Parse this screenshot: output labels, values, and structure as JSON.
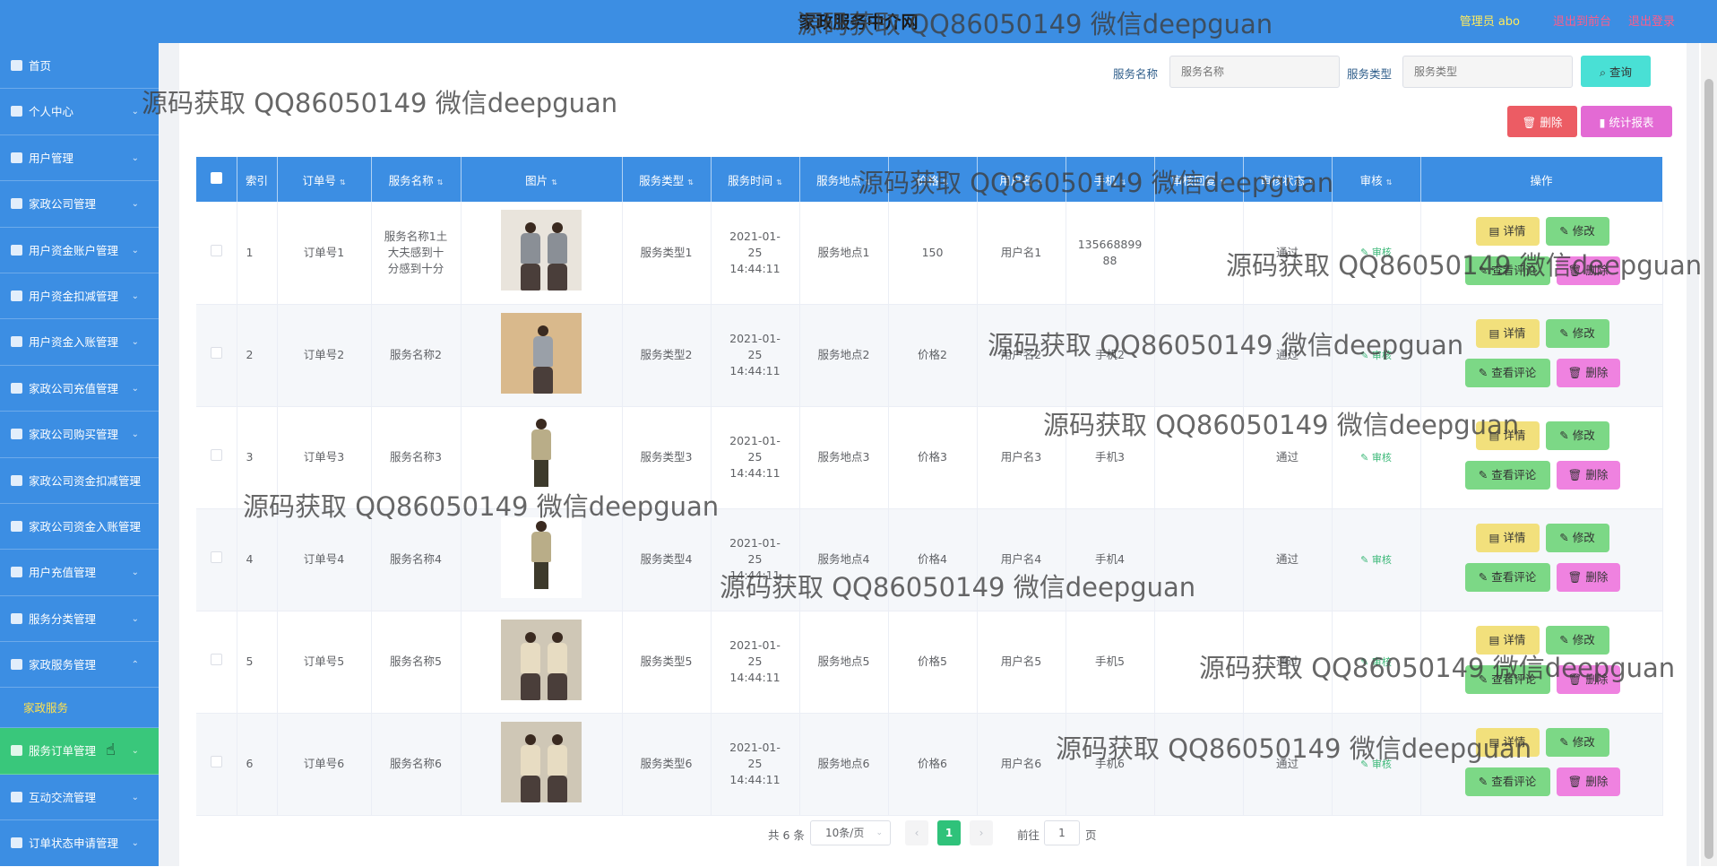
{
  "header": {
    "title": "家政服务中介网",
    "admin_label": "管理员 abo",
    "front_label": "退出到前台",
    "logout_label": "退出登录"
  },
  "sidebar": {
    "items": [
      {
        "label": "首页",
        "arrow": ""
      },
      {
        "label": "个人中心",
        "arrow": "⌄"
      },
      {
        "label": "用户管理",
        "arrow": "⌄"
      },
      {
        "label": "家政公司管理",
        "arrow": "⌄"
      },
      {
        "label": "用户资金账户管理",
        "arrow": "⌄"
      },
      {
        "label": "用户资金扣减管理",
        "arrow": "⌄"
      },
      {
        "label": "用户资金入账管理",
        "arrow": "⌄"
      },
      {
        "label": "家政公司充值管理",
        "arrow": "⌄"
      },
      {
        "label": "家政公司购买管理",
        "arrow": "⌄"
      },
      {
        "label": "家政公司资金扣减管理",
        "arrow": "⌄"
      },
      {
        "label": "家政公司资金入账管理",
        "arrow": "⌄"
      },
      {
        "label": "用户充值管理",
        "arrow": "⌄"
      },
      {
        "label": "服务分类管理",
        "arrow": "⌄"
      },
      {
        "label": "家政服务管理",
        "arrow": "⌃"
      }
    ],
    "sub_item": "家政服务",
    "tail_items": [
      {
        "label": "服务订单管理",
        "arrow": "⌄",
        "active": true
      },
      {
        "label": "互动交流管理",
        "arrow": "⌄"
      },
      {
        "label": "订单状态申请管理",
        "arrow": "⌄"
      }
    ]
  },
  "search": {
    "name_label": "服务名称",
    "name_placeholder": "服务名称",
    "type_label": "服务类型",
    "type_placeholder": "服务类型",
    "query_label": "⌕ 查询",
    "delete_label": "🗑 删除",
    "report_label": "▮ 统计报表"
  },
  "table": {
    "headers": [
      "索引",
      "订单号",
      "服务名称",
      "图片",
      "服务类型",
      "服务时间",
      "服务地点",
      "价格",
      "用户名",
      "手机",
      "审核回复",
      "审核状态",
      "审核",
      "操作"
    ],
    "rows": [
      {
        "index": "1",
        "order": "订单号1",
        "name": "服务名称1土大夫感到十分感到十分",
        "type": "服务类型1",
        "time": "2021-01-25 14:44:11",
        "place": "服务地点1",
        "price": "150",
        "user": "用户名1",
        "phone": "13566889988",
        "reply": "",
        "status": "通过",
        "photo": "couple-grey"
      },
      {
        "index": "2",
        "order": "订单号2",
        "name": "服务名称2",
        "type": "服务类型2",
        "time": "2021-01-25 14:44:11",
        "place": "服务地点2",
        "price": "价格2",
        "user": "用户名2",
        "phone": "手机2",
        "reply": "",
        "status": "通过",
        "photo": "woman-grey"
      },
      {
        "index": "3",
        "order": "订单号3",
        "name": "服务名称3",
        "type": "服务类型3",
        "time": "2021-01-25 14:44:11",
        "place": "服务地点3",
        "price": "价格3",
        "user": "用户名3",
        "phone": "手机3",
        "reply": "",
        "status": "通过",
        "photo": "man-khaki"
      },
      {
        "index": "4",
        "order": "订单号4",
        "name": "服务名称4",
        "type": "服务类型4",
        "time": "2021-01-25 14:44:11",
        "place": "服务地点4",
        "price": "价格4",
        "user": "用户名4",
        "phone": "手机4",
        "reply": "",
        "status": "通过",
        "photo": "man-khaki"
      },
      {
        "index": "5",
        "order": "订单号5",
        "name": "服务名称5",
        "type": "服务类型5",
        "time": "2021-01-25 14:44:11",
        "place": "服务地点5",
        "price": "价格5",
        "user": "用户名5",
        "phone": "手机5",
        "reply": "",
        "status": "通过",
        "photo": "couple-beige"
      },
      {
        "index": "6",
        "order": "订单号6",
        "name": "服务名称6",
        "type": "服务类型6",
        "time": "2021-01-25 14:44:11",
        "place": "服务地点6",
        "price": "价格6",
        "user": "用户名6",
        "phone": "手机6",
        "reply": "",
        "status": "通过",
        "photo": "couple-beige"
      }
    ],
    "review_label": "✎ 审核",
    "actions": {
      "detail": "▤ 详情",
      "edit": "✎ 修改",
      "comment": "✎ 查看评论",
      "delete": "🗑 删除"
    }
  },
  "pagination": {
    "total": "共 6 条",
    "page_size": "10条/页",
    "current": "1",
    "goto_label": "前往",
    "goto_value": "1",
    "page_label": "页",
    "prev": "‹",
    "next": "›"
  },
  "watermarks": [
    "源码获取 QQ86050149 微信deepguan",
    "源码获取 QQ86050149 微信deepguan",
    "源码获取 QQ86050149 微信deepguan",
    "源码获取 QQ86050149 微信deepguan",
    "源码获取 QQ86050149 微信deepguan",
    "源码获取 QQ86050149 微信deepguan",
    "源码获取 QQ86050149 微信deepguan",
    "源码获取 QQ86050149 微信deepguan",
    "源码获取 QQ86050149 微信deepguan",
    "源码获取 QQ86050149 微信deepguan"
  ],
  "colors": {
    "primary": "#3c8ee3",
    "active_menu": "#39c77b",
    "detail_btn": "#f2e07c",
    "edit_btn": "#7cd886",
    "delete_btn": "#ef82e0"
  }
}
